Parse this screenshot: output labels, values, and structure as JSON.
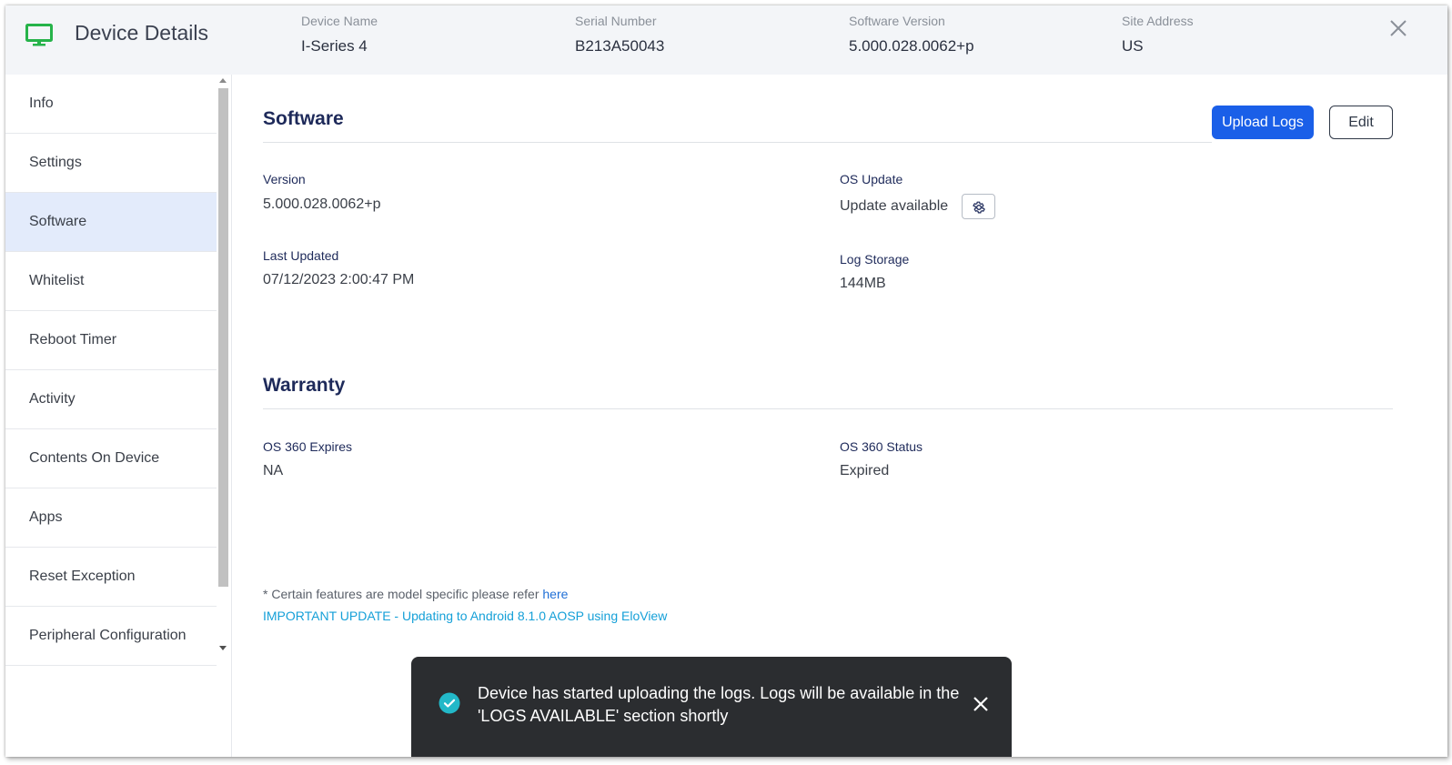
{
  "header": {
    "title": "Device Details",
    "icon": "monitor-icon",
    "accent_color": "#26b34a",
    "fields": [
      {
        "label": "Device Name",
        "value": "I-Series 4"
      },
      {
        "label": "Serial Number",
        "value": "B213A50043"
      },
      {
        "label": "Software Version",
        "value": "5.000.028.0062+p"
      },
      {
        "label": "Site Address",
        "value": "US"
      }
    ]
  },
  "sidebar": {
    "active": "Software",
    "items": [
      {
        "label": "Info"
      },
      {
        "label": "Settings"
      },
      {
        "label": "Software"
      },
      {
        "label": "Whitelist"
      },
      {
        "label": "Reboot Timer"
      },
      {
        "label": "Activity"
      },
      {
        "label": "Contents On Device"
      },
      {
        "label": "Apps"
      },
      {
        "label": "Reset Exception"
      },
      {
        "label": "Peripheral Configuration"
      }
    ]
  },
  "software": {
    "title": "Software",
    "upload_logs_label": "Upload Logs",
    "edit_label": "Edit",
    "version_label": "Version",
    "version_value": "5.000.028.0062+p",
    "os_update_label": "OS Update",
    "os_update_value": "Update available",
    "last_updated_label": "Last Updated",
    "last_updated_value": "07/12/2023 2:00:47 PM",
    "log_storage_label": "Log Storage",
    "log_storage_value": "144MB"
  },
  "warranty": {
    "title": "Warranty",
    "os360_expires_label": "OS 360 Expires",
    "os360_expires_value": "NA",
    "os360_status_label": "OS 360 Status",
    "os360_status_value": "Expired"
  },
  "footer": {
    "note_text": "* Certain features are model specific please refer",
    "note_link": "here",
    "important_link": "IMPORTANT UPDATE - Updating to Android 8.1.0 AOSP using EloView"
  },
  "toast": {
    "message": "Device has started uploading the logs. Logs will be available in the 'LOGS AVAILABLE' section shortly",
    "icon": "check-circle-icon",
    "icon_color": "#22b8c8"
  },
  "colors": {
    "primary": "#1a5fe8",
    "active_nav_bg": "#e3ebfb",
    "heading": "#1e2a5a"
  }
}
